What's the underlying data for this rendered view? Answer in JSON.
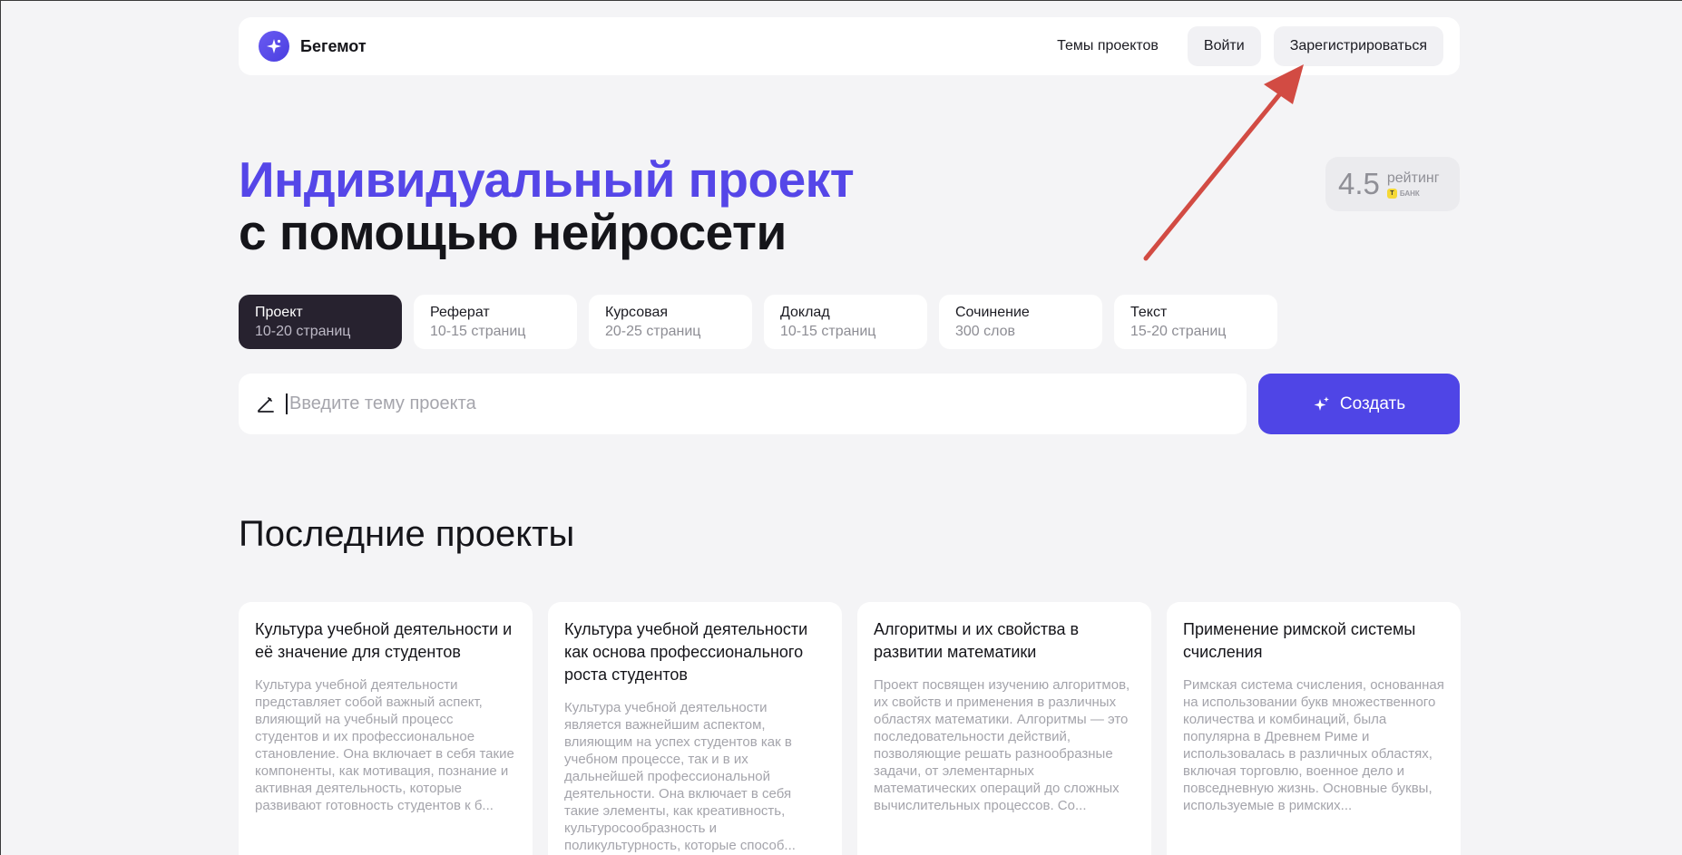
{
  "header": {
    "logo_text": "Бегемот",
    "nav_topics": "Темы проектов",
    "login": "Войти",
    "register": "Зарегистрироваться"
  },
  "hero": {
    "title_line1": "Индивидуальный проект",
    "title_line2": "с помощью нейросети"
  },
  "rating": {
    "value": "4.5",
    "label": "рейтинг",
    "bank": "БАНК",
    "bank_badge": "T"
  },
  "types": [
    {
      "name": "Проект",
      "sub": "10-20 страниц",
      "active": true
    },
    {
      "name": "Реферат",
      "sub": "10-15 страниц",
      "active": false
    },
    {
      "name": "Курсовая",
      "sub": "20-25 страниц",
      "active": false
    },
    {
      "name": "Доклад",
      "sub": "10-15 страниц",
      "active": false
    },
    {
      "name": "Сочинение",
      "sub": "300 слов",
      "active": false
    },
    {
      "name": "Текст",
      "sub": "15-20 страниц",
      "active": false
    }
  ],
  "topic_input": {
    "placeholder": "Введите тему проекта",
    "value": ""
  },
  "create_button": "Создать",
  "recent": {
    "title": "Последние проекты",
    "cards": [
      {
        "title": "Культура учебной деятельности и её значение для студентов",
        "description": "Культура учебной деятельности представляет собой важный аспект, влияющий на учебный процесс студентов и их профессиональное становление. Она включает в себя такие компоненты, как мотивация, познание и активная деятельность, которые развивают готовность студентов к б..."
      },
      {
        "title": "Культура учебной деятельности как основа профессионального роста студентов",
        "description": "Культура учебной деятельности является важнейшим аспектом, влияющим на успех студентов как в учебном процессе, так и в их дальнейшей профессиональной деятельности. Она включает в себя такие элементы, как креативность, культуросообразность и поликультурность, которые способ..."
      },
      {
        "title": "Алгоритмы и их свойства в развитии математики",
        "description": "Проект посвящен изучению алгоритмов, их свойств и применения в различных областях математики. Алгоритмы — это последовательности действий, позволяющие решать разнообразные задачи, от элементарных математических операций до сложных вычислительных процессов. Со..."
      },
      {
        "title": "Применение римской системы счисления",
        "description": "Римская система счисления, основанная на использовании букв множественного количества и комбинаций, была популярна в Древнем Риме и использовалась в различных областях, включая торговлю, военное дело и повседневную жизнь. Основные буквы, используемые в римских..."
      }
    ]
  },
  "colors": {
    "accent": "#4f45e6",
    "title_accent": "#5546e8",
    "active_type": "#27222f",
    "annotation_arrow": "#d24b43"
  }
}
